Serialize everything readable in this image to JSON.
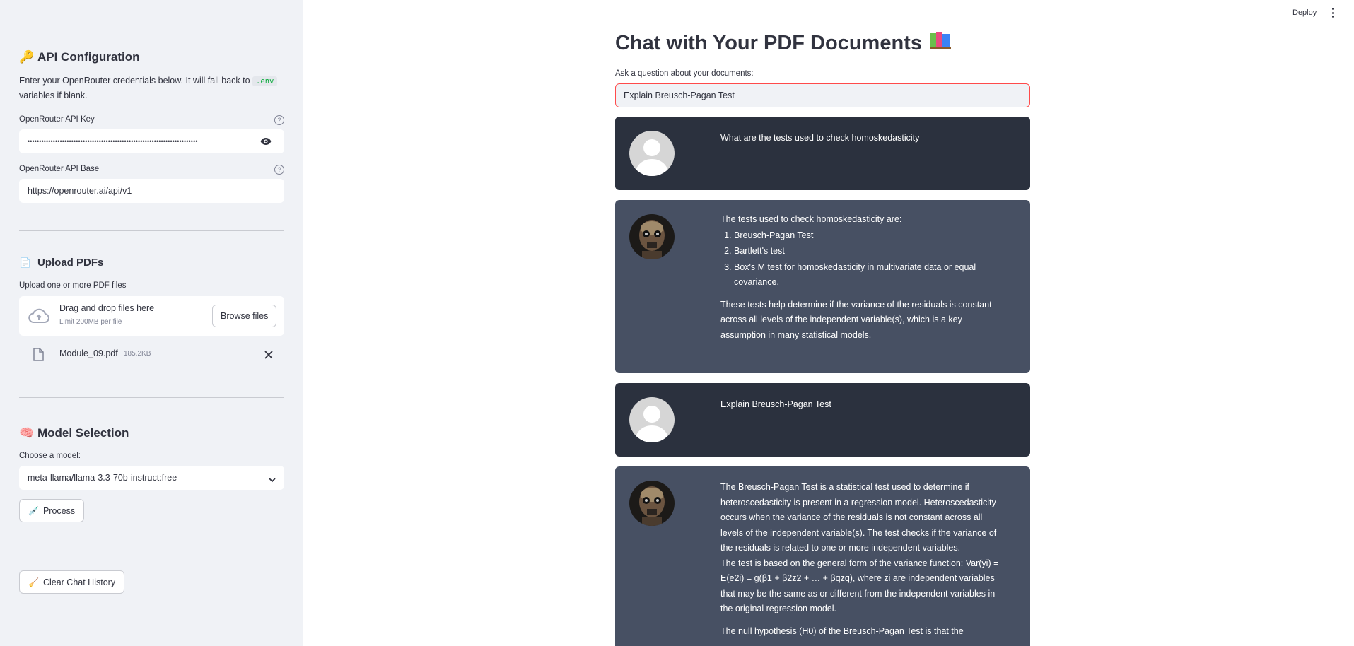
{
  "toolbar": {
    "deploy_label": "Deploy"
  },
  "sidebar": {
    "api": {
      "heading": "API Configuration",
      "desc_before": "Enter your OpenRouter credentials below. It will fall back to",
      "desc_code": ".env",
      "desc_after": "variables if blank.",
      "key_label": "OpenRouter API Key",
      "key_value": "••••••••••••••••••••••••••••••••••••••••••••••••••••••••••••••••••••••••••",
      "base_label": "OpenRouter API Base",
      "base_value": "https://openrouter.ai/api/v1"
    },
    "upload": {
      "heading": "Upload PDFs",
      "label": "Upload one or more PDF files",
      "drop_title": "Drag and drop files here",
      "drop_limit": "Limit 200MB per file",
      "browse_label": "Browse files",
      "file_name": "Module_09.pdf",
      "file_size": "185.2KB"
    },
    "model": {
      "heading": "Model Selection",
      "label": "Choose a model:",
      "selected": "meta-llama/llama-3.3-70b-instruct:free",
      "process_label": "Process"
    },
    "clear_label": "Clear Chat History"
  },
  "main": {
    "title": "Chat with Your PDF Documents",
    "question_label": "Ask a question about your documents:",
    "question_value": "Explain Breusch-Pagan Test",
    "messages": [
      {
        "role": "user",
        "text": "What are the tests used to check homoskedasticity"
      },
      {
        "role": "bot",
        "intro": "The tests used to check homoskedasticity are:",
        "items": [
          "Breusch-Pagan Test",
          "Bartlett's test",
          "Box's M test for homoskedasticity in multivariate data or equal covariance."
        ],
        "outro": "These tests help determine if the variance of the residuals is constant across all levels of the independent variable(s), which is a key assumption in many statistical models."
      },
      {
        "role": "user",
        "text": "Explain Breusch-Pagan Test"
      },
      {
        "role": "bot",
        "p1": "The Breusch-Pagan Test is a statistical test used to determine if heteroscedasticity is present in a regression model. Heteroscedasticity occurs when the variance of the residuals is not constant across all levels of the independent variable(s). The test checks if the variance of the residuals is related to one or more independent variables.",
        "p2": "The test is based on the general form of the variance function: Var(yi) = E(e2i) = g(β1 + β2z2 + … + βqzq), where zi are independent variables that may be the same as or different from the independent variables in the original regression model.",
        "p3": "The null hypothesis (H0) of the Breusch-Pagan Test is that the"
      }
    ]
  }
}
